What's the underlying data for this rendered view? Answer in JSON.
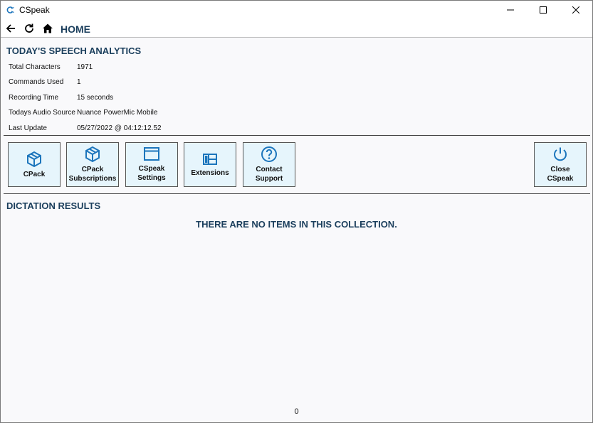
{
  "window": {
    "title": "CSpeak"
  },
  "nav": {
    "title": "HOME"
  },
  "analytics": {
    "title": "TODAY'S SPEECH ANALYTICS",
    "rows": [
      {
        "label": "Total Characters",
        "value": "1971"
      },
      {
        "label": "Commands Used",
        "value": "1"
      },
      {
        "label": "Recording Time",
        "value": "15 seconds"
      },
      {
        "label": "Todays Audio Source",
        "value": "Nuance PowerMic Mobile"
      },
      {
        "label": "Last Update",
        "value": "05/27/2022 @ 04:12:12.52"
      }
    ]
  },
  "toolbar": {
    "buttons": [
      {
        "label": "CPack",
        "icon": "package-icon"
      },
      {
        "label": "CPack\nSubscriptions",
        "icon": "package-icon"
      },
      {
        "label": "CSpeak\nSettings",
        "icon": "window-settings-icon"
      },
      {
        "label": "Extensions",
        "icon": "layout-icon"
      },
      {
        "label": "Contact\nSupport",
        "icon": "help-icon"
      },
      {
        "label": "Close\nCSpeak",
        "icon": "power-icon"
      }
    ]
  },
  "results": {
    "title": "DICTATION RESULTS",
    "empty_message": "THERE ARE NO ITEMS IN THIS COLLECTION.",
    "count": "0"
  },
  "colors": {
    "accent": "#1a3e5c",
    "icon": "#1c75bc",
    "tile_bg": "#e6f5fc"
  }
}
